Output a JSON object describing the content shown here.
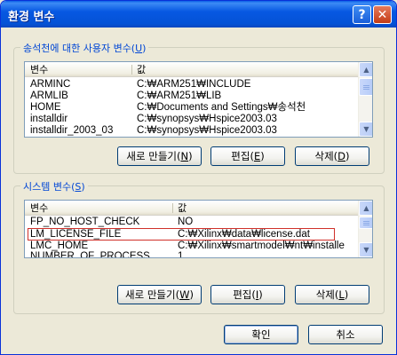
{
  "window": {
    "title": "환경 변수",
    "help_glyph": "?",
    "close_glyph": "✕"
  },
  "user_vars": {
    "group_label_prefix": "송석천에 대한 사용자 변수(",
    "group_label_key": "U",
    "group_label_suffix": ")",
    "columns": [
      "변수",
      "값"
    ],
    "rows": [
      {
        "name": "ARMINC",
        "value": "C:₩ARM251₩INCLUDE"
      },
      {
        "name": "ARMLIB",
        "value": "C:₩ARM251₩LIB"
      },
      {
        "name": "HOME",
        "value": "C:₩Documents and Settings₩송석천"
      },
      {
        "name": "installdir",
        "value": "C:₩synopsys₩Hspice2003.03"
      },
      {
        "name": "installdir_2003_03",
        "value": "C:₩synopsys₩Hspice2003.03"
      }
    ],
    "buttons": {
      "new": {
        "prefix": "새로 만들기(",
        "key": "N",
        "suffix": ")"
      },
      "edit": {
        "prefix": "편집(",
        "key": "E",
        "suffix": ")"
      },
      "delete": {
        "prefix": "삭제(",
        "key": "D",
        "suffix": ")"
      }
    }
  },
  "system_vars": {
    "group_label_prefix": "시스템 변수(",
    "group_label_key": "S",
    "group_label_suffix": ")",
    "columns": [
      "변수",
      "값"
    ],
    "rows": [
      {
        "name": "FP_NO_HOST_CHECK",
        "value": "NO"
      },
      {
        "name": "LM_LICENSE_FILE",
        "value": "C:₩Xilinx₩data₩license.dat"
      },
      {
        "name": "LMC_HOME",
        "value": "C:₩Xilinx₩smartmodel₩nt₩installe"
      },
      {
        "name": "NUMBER_OF_PROCESS...",
        "value": "1"
      }
    ],
    "buttons": {
      "new": {
        "prefix": "새로 만들기(",
        "key": "W",
        "suffix": ")"
      },
      "edit": {
        "prefix": "편집(",
        "key": "I",
        "suffix": ")"
      },
      "delete": {
        "prefix": "삭제(",
        "key": "L",
        "suffix": ")"
      }
    }
  },
  "dialog_buttons": {
    "ok": "확인",
    "cancel": "취소"
  },
  "colors": {
    "titlebar": "#0758e2",
    "group_label": "#0046d5",
    "highlight_outline": "#d0302a"
  }
}
